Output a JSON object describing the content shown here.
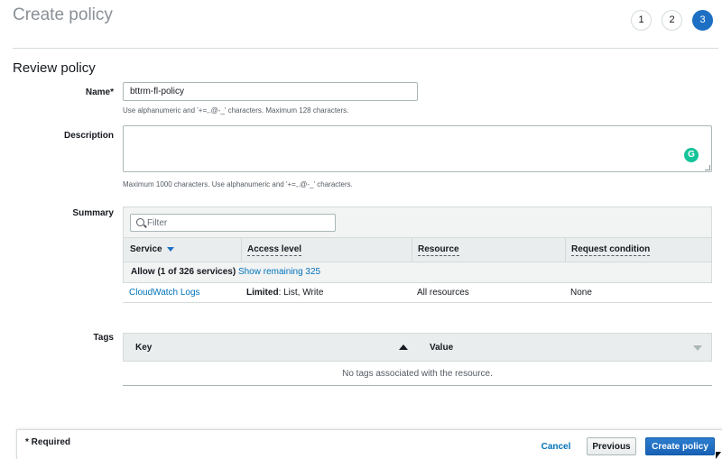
{
  "page": {
    "title": "Create policy",
    "steps": [
      "1",
      "2",
      "3"
    ],
    "active_step": "3"
  },
  "review": {
    "section_title": "Review policy",
    "name_label": "Name*",
    "name_value": "bttrm-fl-policy",
    "name_hint": "Use alphanumeric and '+=,.@-_' characters. Maximum 128 characters.",
    "description_label": "Description",
    "description_value": "",
    "description_hint": "Maximum 1000 characters. Use alphanumeric and '+=,.@-_' characters."
  },
  "summary": {
    "label": "Summary",
    "filter_placeholder": "Filter",
    "columns": [
      "Service",
      "Access level",
      "Resource",
      "Request condition"
    ],
    "group": {
      "allow_text": "Allow (1 of 326 services)",
      "show_remaining": "Show remaining 325"
    },
    "rows": [
      {
        "service": "CloudWatch Logs",
        "access_bold": "Limited",
        "access_rest": ": List, Write",
        "resource": "All resources",
        "condition": "None"
      }
    ]
  },
  "tags": {
    "label": "Tags",
    "columns": [
      "Key",
      "Value"
    ],
    "empty_message": "No tags associated with the resource."
  },
  "footer": {
    "required_note": "* Required",
    "cancel_label": "Cancel",
    "previous_label": "Previous",
    "create_label": "Create policy"
  },
  "colors": {
    "primary": "#1d6fc3",
    "link": "#0073bb"
  }
}
